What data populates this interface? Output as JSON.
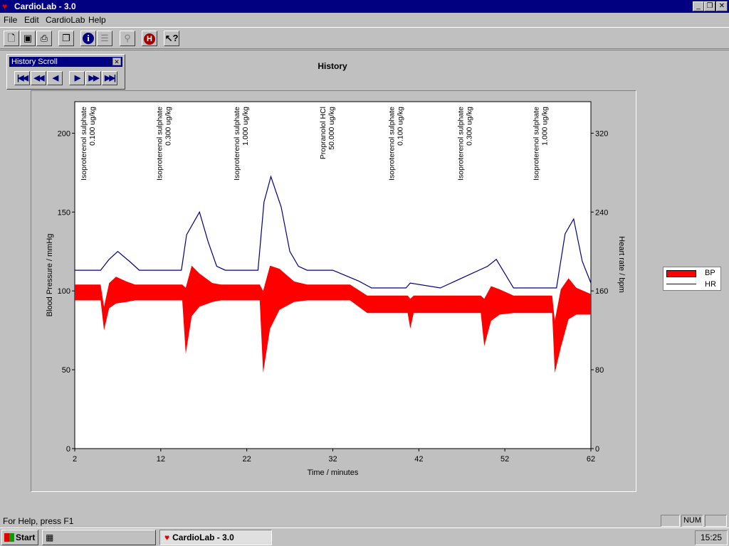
{
  "window": {
    "title": "CardioLab - 3.0",
    "btn_min": "_",
    "btn_restore": "❐",
    "btn_close": "✕"
  },
  "menu": [
    "File",
    "Edit",
    "CardioLab",
    "Help"
  ],
  "toolbar": {
    "icons": [
      "new-icon",
      "save-icon",
      "print-icon",
      "copy-icon",
      "info-icon",
      "notes-icon",
      "syringe-icon",
      "hint-icon",
      "context-help-icon"
    ]
  },
  "history_scroll": {
    "title": "History Scroll",
    "close": "✕",
    "buttons": [
      {
        "name": "first-button",
        "glyph": "|◀◀"
      },
      {
        "name": "fast-back-button",
        "glyph": "◀◀"
      },
      {
        "name": "back-button",
        "glyph": "◀"
      },
      {
        "name": "forward-button",
        "glyph": "▶"
      },
      {
        "name": "fast-forward-button",
        "glyph": "▶▶"
      },
      {
        "name": "last-button",
        "glyph": "▶▶|"
      }
    ]
  },
  "chart_title": "History",
  "chart_data": {
    "type": "area",
    "xlabel": "Time / minutes",
    "ylabel_left": "Blood Pressure / mmHg",
    "ylabel_right": "Heart rate / bpm",
    "xlim": [
      2,
      62
    ],
    "ylim_left": [
      0,
      220
    ],
    "ylim_right": [
      0,
      352
    ],
    "x_ticks": [
      2,
      12,
      22,
      32,
      42,
      52,
      62
    ],
    "y_ticks_left": [
      0,
      50,
      100,
      150,
      200
    ],
    "y_ticks_right": [
      0,
      80,
      160,
      240,
      320
    ],
    "grid": false,
    "legend": "right",
    "colors": {
      "BP": "#ff0000",
      "HR": "#000080"
    },
    "annotations": [
      {
        "x": 2.5,
        "lines": [
          "Isoproterenol sulphate",
          "0.100 ug/kg"
        ]
      },
      {
        "x": 11.3,
        "lines": [
          "Isoproterenol sulphate",
          "0.300 ug/kg"
        ]
      },
      {
        "x": 20.3,
        "lines": [
          "Isoproterenol sulphate",
          "1.000 ug/kg"
        ]
      },
      {
        "x": 30.3,
        "lines": [
          "Propranolol HCl",
          "50.000 ug/kg"
        ]
      },
      {
        "x": 38.3,
        "lines": [
          "Isoproterenol sulphate",
          "0.100 ug/kg"
        ]
      },
      {
        "x": 46.3,
        "lines": [
          "Isoproterenol sulphate",
          "0.300 ug/kg"
        ]
      },
      {
        "x": 55.1,
        "lines": [
          "Isoproterenol sulphate",
          "1.000 ug/kg"
        ]
      }
    ],
    "series": [
      {
        "name": "BP",
        "x": [
          2,
          5,
          5.4,
          6,
          6.8,
          8,
          9,
          14.5,
          14.9,
          15.6,
          16.5,
          18,
          19,
          23.5,
          23.9,
          24.7,
          25.8,
          27.5,
          29,
          34,
          36,
          40.7,
          41,
          41.4,
          42,
          49.2,
          49.6,
          50.4,
          51.4,
          53,
          57.5,
          57.8,
          58.5,
          59.4,
          60.3,
          62
        ],
        "upper": [
          104,
          104,
          90,
          105,
          109,
          106,
          104,
          104,
          102,
          116,
          111,
          105,
          104,
          104,
          100,
          116,
          114,
          106,
          104,
          104,
          97,
          97,
          95,
          97,
          97,
          97,
          95,
          103,
          101,
          97,
          97,
          81,
          101,
          108,
          102,
          98
        ],
        "lower": [
          94,
          94,
          75,
          89,
          92,
          93,
          94,
          94,
          60,
          84,
          90,
          93,
          94,
          94,
          48,
          76,
          88,
          93,
          94,
          94,
          86,
          86,
          76,
          86,
          86,
          86,
          65,
          81,
          85,
          86,
          86,
          48,
          64,
          82,
          85,
          85
        ]
      },
      {
        "name": "HR",
        "x": [
          2,
          5,
          6,
          7,
          8.5,
          9.5,
          14.4,
          15,
          16.5,
          17.5,
          18.5,
          19.5,
          23.3,
          24,
          24.8,
          26,
          27,
          28,
          29,
          32,
          35,
          36.5,
          40.5,
          41,
          44.5,
          50,
          51,
          53,
          58,
          59,
          60,
          61,
          62
        ],
        "values": [
          181,
          181,
          192,
          200,
          189,
          181,
          181,
          217,
          240,
          210,
          185,
          181,
          181,
          250,
          276,
          245,
          200,
          185,
          181,
          181,
          170,
          163,
          163,
          168,
          163,
          185,
          192,
          163,
          163,
          218,
          233,
          190,
          168
        ]
      }
    ]
  },
  "status": {
    "help": "For Help, press F1",
    "num": "NUM",
    "blank": ""
  },
  "taskbar": {
    "start": "Start",
    "task": "CardioLab - 3.0",
    "clock": "15:25"
  }
}
